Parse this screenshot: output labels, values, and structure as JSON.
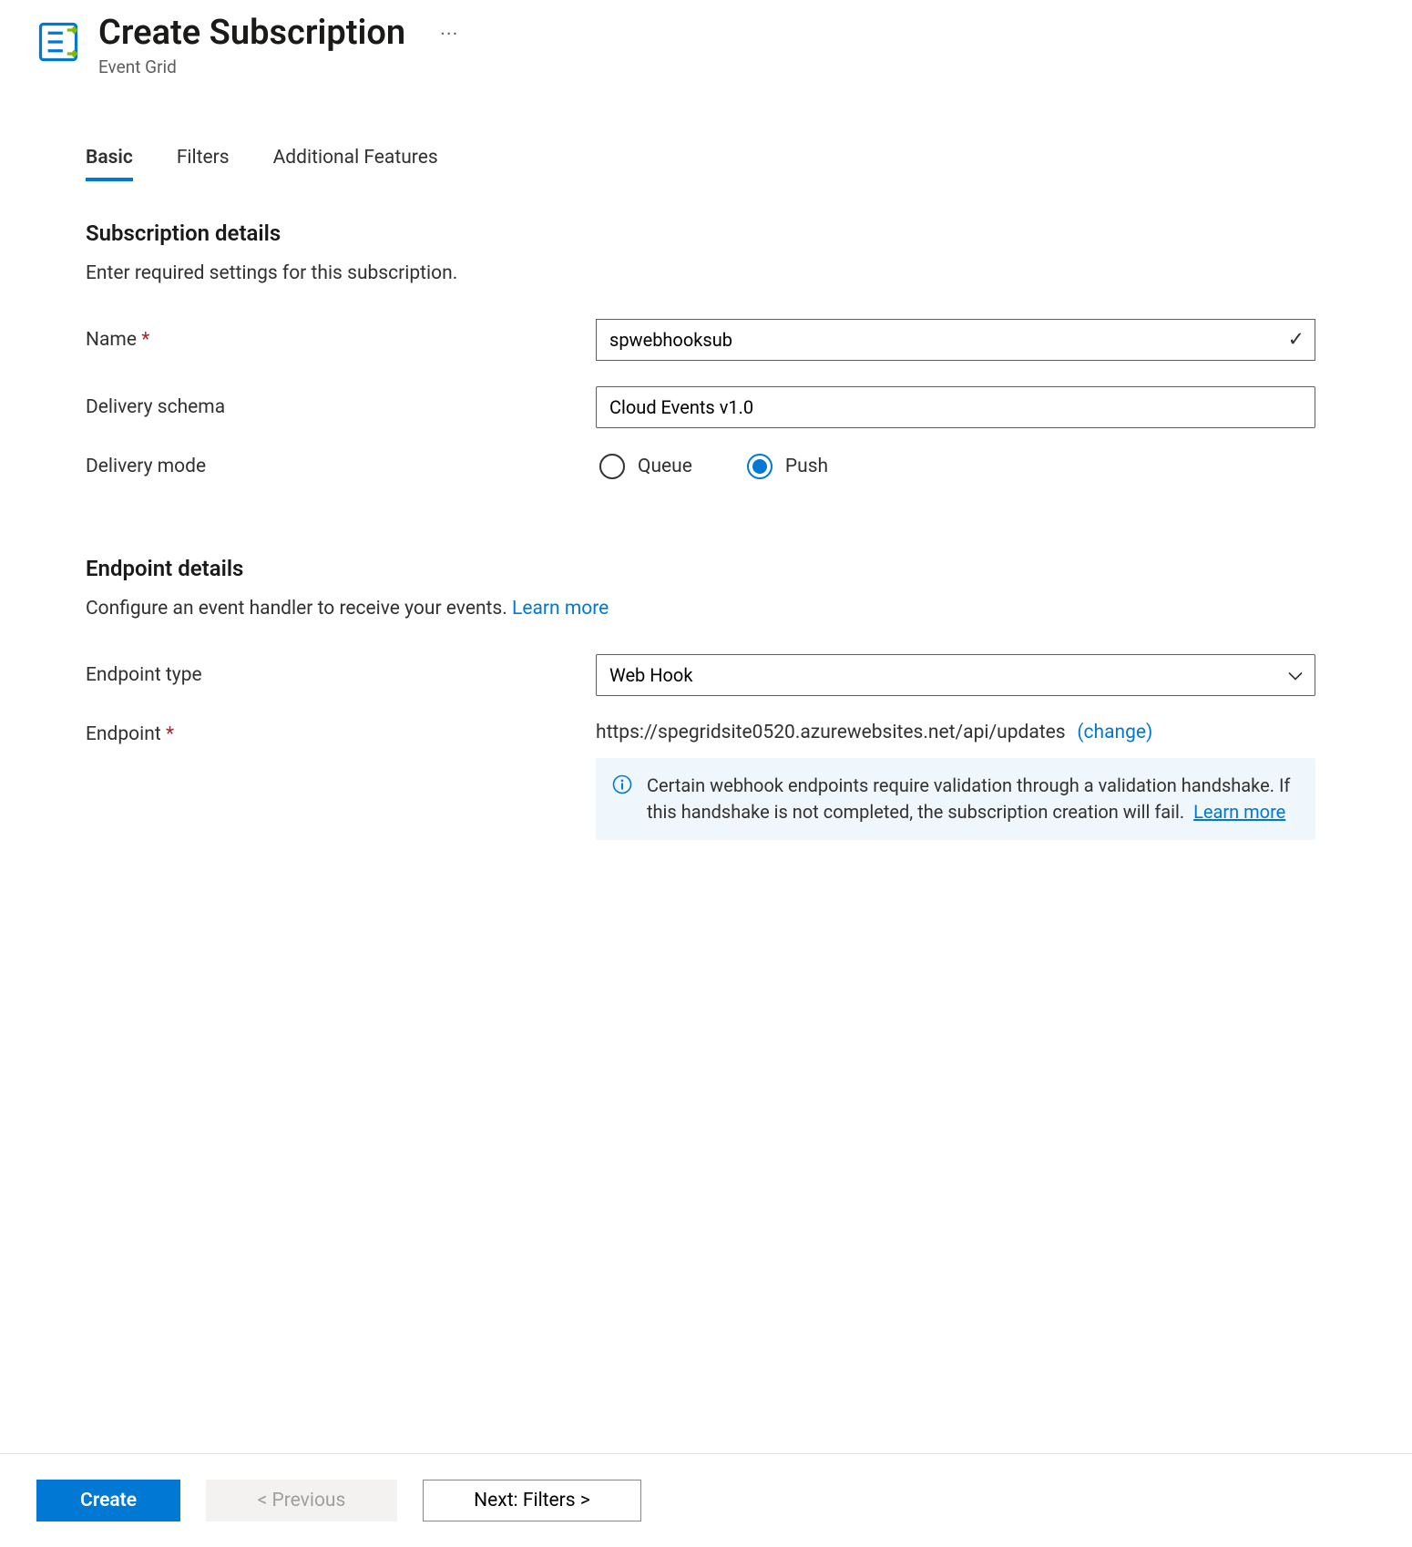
{
  "header": {
    "title": "Create Subscription",
    "subtitle": "Event Grid",
    "more_label": "···"
  },
  "tabs": [
    {
      "label": "Basic",
      "active": true
    },
    {
      "label": "Filters",
      "active": false
    },
    {
      "label": "Additional Features",
      "active": false
    }
  ],
  "subscription": {
    "section_title": "Subscription details",
    "section_desc": "Enter required settings for this subscription.",
    "name_label": "Name",
    "name_value": "spwebhooksub",
    "schema_label": "Delivery schema",
    "schema_value": "Cloud Events v1.0",
    "mode_label": "Delivery mode",
    "mode_options": {
      "queue": "Queue",
      "push": "Push"
    },
    "mode_selected": "push"
  },
  "endpoint": {
    "section_title": "Endpoint details",
    "section_desc": "Configure an event handler to receive your events.",
    "learn_more": "Learn more",
    "type_label": "Endpoint type",
    "type_value": "Web Hook",
    "endpoint_label": "Endpoint",
    "endpoint_value": "https://spegridsite0520.azurewebsites.net/api/updates",
    "change_label": "(change)",
    "info_text": "Certain webhook endpoints require validation through a validation handshake. If this handshake is not completed, the subscription creation will fail.",
    "info_learn_more": "Learn more"
  },
  "footer": {
    "create": "Create",
    "prev": "< Previous",
    "next": "Next: Filters >"
  }
}
